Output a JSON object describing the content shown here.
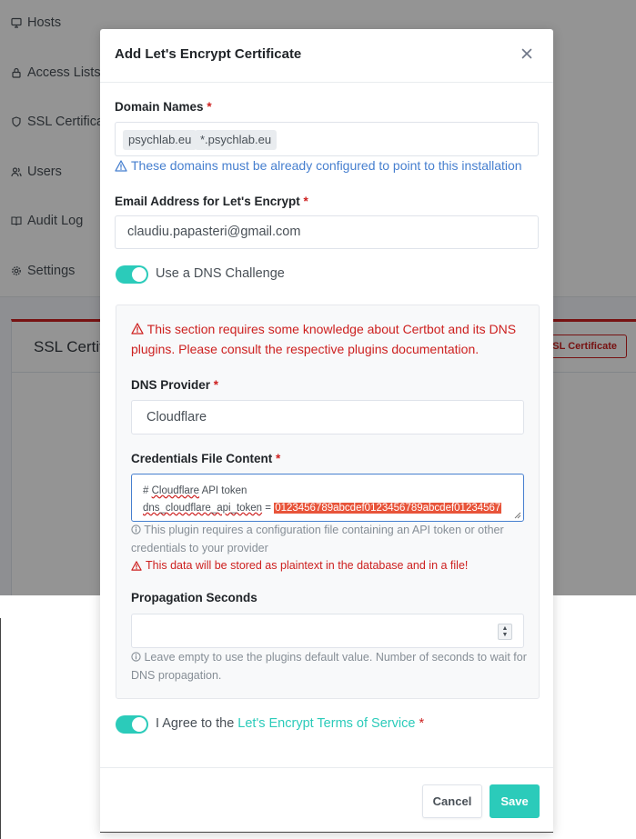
{
  "background": {
    "nav": [
      {
        "label": "Hosts",
        "icon": "monitor-icon"
      },
      {
        "label": "Access Lists",
        "icon": "lock-icon"
      },
      {
        "label": "SSL Certificates",
        "icon": "shield-icon"
      },
      {
        "label": "Users",
        "icon": "users-icon"
      },
      {
        "label": "Audit Log",
        "icon": "book-icon"
      },
      {
        "label": "Settings",
        "icon": "gear-icon"
      }
    ],
    "card_title": "SSL Certificates",
    "card_button": "Add SSL Certificate"
  },
  "modal": {
    "title": "Add Let's Encrypt Certificate",
    "domains": {
      "label": "Domain Names",
      "tags": [
        "psychlab.eu",
        "*.psychlab.eu"
      ],
      "hint": "These domains must be already configured to point to this installation"
    },
    "email": {
      "label": "Email Address for Let's Encrypt",
      "value": "claudiu.papasteri@gmail.com"
    },
    "dns_challenge": {
      "label": "Use a DNS Challenge",
      "enabled": true
    },
    "dns_section": {
      "warning": "This section requires some knowledge about Certbot and its DNS plugins. Please consult the respective plugins documentation.",
      "provider_label": "DNS Provider",
      "provider_value": "Cloudflare",
      "credentials_label": "Credentials File Content",
      "credentials_line1_prefix": "# ",
      "credentials_line1_word": "Cloudflare",
      "credentials_line1_rest": " API token",
      "credentials_line2_key": "dns_cloudflare_api_token",
      "credentials_line2_eq": " = ",
      "credentials_line2_token": "0123456789abcdef0123456789abcdef01234567",
      "credentials_hint": "This plugin requires a configuration file containing an API token or other credentials to your provider",
      "credentials_warning": "This data will be stored as plaintext in the database and in a file!",
      "propagation_label": "Propagation Seconds",
      "propagation_value": "",
      "propagation_hint": "Leave empty to use the plugins default value. Number of seconds to wait for DNS propagation."
    },
    "agree": {
      "prefix": "I Agree to the ",
      "link": "Let's Encrypt Terms of Service",
      "enabled": true
    },
    "cancel_label": "Cancel",
    "save_label": "Save"
  },
  "colors": {
    "accent": "#2bcbba",
    "danger": "#cd201f",
    "info": "#467fcf"
  }
}
